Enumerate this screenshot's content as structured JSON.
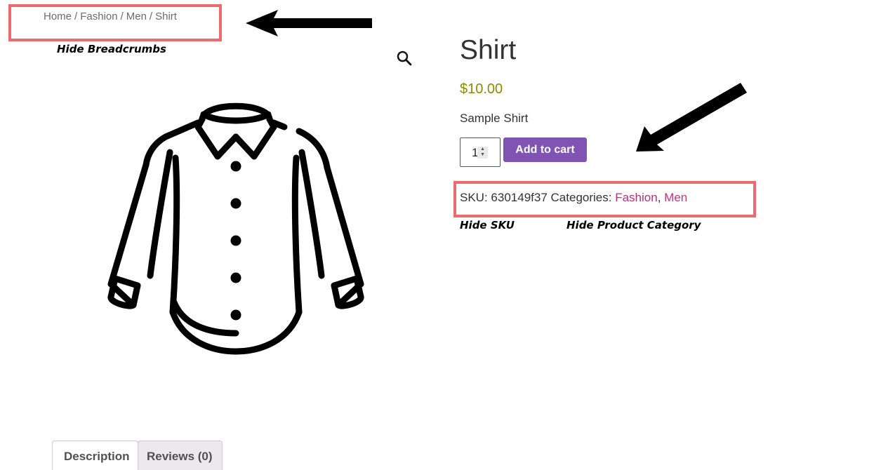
{
  "breadcrumb": {
    "items": [
      "Home",
      "Fashion",
      "Men"
    ],
    "current": "Shirt",
    "separator": "/"
  },
  "annotations": {
    "breadcrumbs": "Hide Breadcrumbs",
    "sku": "Hide SKU",
    "category": "Hide Product Category",
    "highlight_color": "#ef6a6e"
  },
  "product": {
    "title": "Shirt",
    "price": "$10.00",
    "short_description": "Sample Shirt",
    "quantity": "1",
    "add_to_cart_label": "Add to cart",
    "sku_label": "SKU:",
    "sku": "630149f37",
    "categories_label": "Categories:",
    "categories": [
      "Fashion",
      "Men"
    ],
    "category_separator": ","
  },
  "icons": {
    "zoom": "magnifier-icon",
    "image": "shirt-outline-image"
  },
  "tabs": {
    "description": "Description",
    "reviews": "Reviews (0)"
  },
  "colors": {
    "accent_button": "#7f54b3",
    "price": "#8a8c00",
    "link": "#c13584"
  }
}
